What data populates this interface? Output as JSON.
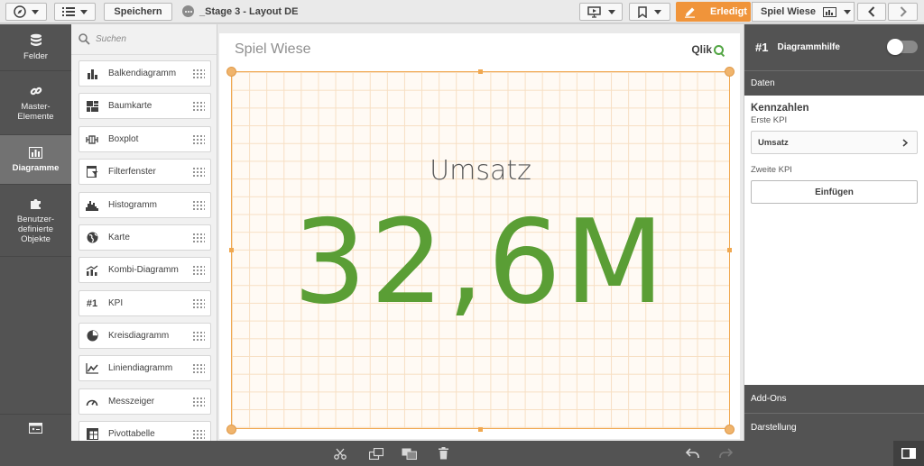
{
  "toolbar": {
    "save_label": "Speichern",
    "doc_title": "_Stage 3 - Layout DE",
    "done_label": "Erledigt",
    "sheet_label": "Spiel Wiese"
  },
  "leftnav": {
    "items": [
      {
        "label": "Felder",
        "icon": "database-icon"
      },
      {
        "label": "Master-Elemente",
        "icon": "link-icon"
      },
      {
        "label": "Diagramme",
        "icon": "bar-chart-icon"
      },
      {
        "label": "Benutzer-definierte Objekte",
        "icon": "puzzle-icon"
      }
    ]
  },
  "assets": {
    "search_placeholder": "Suchen",
    "items": [
      {
        "label": "Balkendiagramm",
        "icon": "bar-chart-icon"
      },
      {
        "label": "Baumkarte",
        "icon": "treemap-icon"
      },
      {
        "label": "Boxplot",
        "icon": "boxplot-icon"
      },
      {
        "label": "Filterfenster",
        "icon": "filter-pane-icon"
      },
      {
        "label": "Histogramm",
        "icon": "histogram-icon"
      },
      {
        "label": "Karte",
        "icon": "globe-icon"
      },
      {
        "label": "Kombi-Diagramm",
        "icon": "combo-chart-icon"
      },
      {
        "label": "KPI",
        "icon": "kpi-icon",
        "glyph": "#1"
      },
      {
        "label": "Kreisdiagramm",
        "icon": "pie-chart-icon"
      },
      {
        "label": "Liniendiagramm",
        "icon": "line-chart-icon"
      },
      {
        "label": "Messzeiger",
        "icon": "gauge-icon"
      },
      {
        "label": "Pivottabelle",
        "icon": "pivot-table-icon"
      }
    ]
  },
  "sheet": {
    "title": "Spiel Wiese",
    "logo_text": "Qlik",
    "kpi_label": "Umsatz",
    "kpi_value": "32,6M"
  },
  "rpanel": {
    "number": "#1",
    "title": "Diagrammhilfe",
    "tab_data": "Daten",
    "section_title": "Kennzahlen",
    "first_kpi_label": "Erste KPI",
    "first_kpi_value": "Umsatz",
    "second_kpi_label": "Zweite KPI",
    "insert_label": "Einfügen",
    "addons_label": "Add-Ons",
    "appearance_label": "Darstellung"
  },
  "colors": {
    "accent": "#f0943a",
    "kpi_green": "#5a9e35",
    "panel_dark": "#535353"
  }
}
